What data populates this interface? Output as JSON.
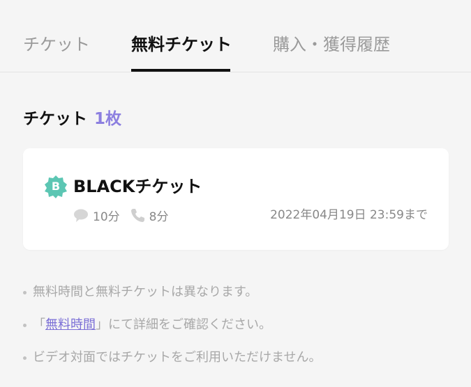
{
  "tabs": [
    {
      "label": "チケット",
      "active": false
    },
    {
      "label": "無料チケット",
      "active": true
    },
    {
      "label": "購入・獲得履歴",
      "active": false
    }
  ],
  "section": {
    "label": "チケット",
    "count": "1枚"
  },
  "ticket": {
    "badge_letter": "B",
    "badge_color": "#5cc6b3",
    "name": "BLACKチケット",
    "chat_icon": "chat-bubble-icon",
    "chat_value": "10分",
    "call_icon": "phone-icon",
    "call_value": "8分",
    "expiry": "2022年04月19日 23:59まで"
  },
  "notes": {
    "line1": "無料時間と無料チケットは異なります。",
    "line2_open": "「",
    "line2_link": "無料時間",
    "line2_close": "」にて詳細をご確認ください。",
    "line3": "ビデオ対面ではチケットをご利用いただけません。"
  },
  "colors": {
    "accent": "#8c7fe0",
    "link": "#7b6fd6",
    "active_tab": "#111111"
  }
}
